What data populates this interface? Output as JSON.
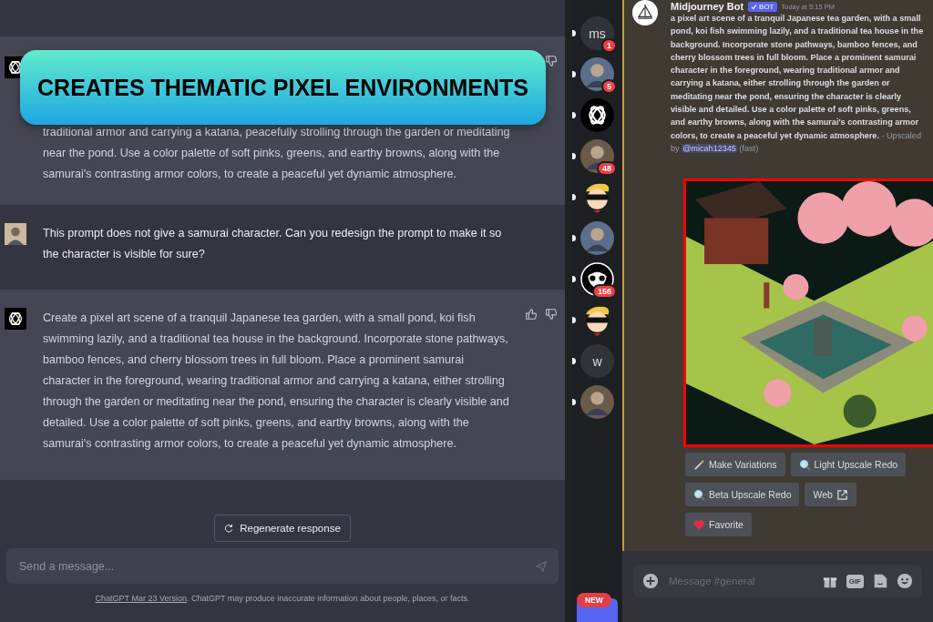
{
  "banner": {
    "text": "CREATES THEMATIC PIXEL ENVIRONMENTS"
  },
  "chat": {
    "messages": [
      {
        "kind": "assistant",
        "text": "traditional armor and carrying a katana, peacefully strolling through the garden or meditating near the pond. Use a color palette of soft pinks, greens, and earthy browns, along with the samurai's contrasting armor colors, to create a peaceful yet dynamic atmosphere."
      },
      {
        "kind": "user",
        "text": "This prompt does not give a samurai character. Can you redesign the prompt to make it so the character is visible for sure?"
      },
      {
        "kind": "assistant",
        "text": "Create a pixel art scene of a tranquil Japanese tea garden, with a small pond, koi fish swimming lazily, and a traditional tea house in the background. Incorporate stone pathways, bamboo fences, and cherry blossom trees in full bloom. Place a prominent samurai character in the foreground, wearing traditional armor and carrying a katana, either strolling through the garden or meditating near the pond, ensuring the character is clearly visible and detailed. Use a color palette of soft pinks, greens, and earthy browns, along with the samurai's contrasting armor colors, to create a peaceful yet dynamic atmosphere."
      }
    ],
    "regenerate_button": "Regenerate response",
    "input": {
      "placeholder": "Send a message..."
    },
    "footer": {
      "link": "ChatGPT Mar 23 Version",
      "text": ". ChatGPT may produce inaccurate information about people, places, or facts."
    }
  },
  "servers": [
    {
      "kind": "text",
      "label": "ms",
      "badge": "1"
    },
    {
      "kind": "avatar",
      "badge": "5"
    },
    {
      "kind": "knot"
    },
    {
      "kind": "avatar",
      "badge": "48"
    },
    {
      "kind": "sunglasses"
    },
    {
      "kind": "avatar"
    },
    {
      "kind": "owl",
      "badge": "156"
    },
    {
      "kind": "sunglasses"
    },
    {
      "kind": "text",
      "label": "w"
    },
    {
      "kind": "avatar"
    }
  ],
  "new_badge": "NEW",
  "discord": {
    "author": "Midjourney Bot",
    "bot_tag": "BOT",
    "timestamp": "Today at 5:15 PM",
    "message": "**a pixel art scene of a tranquil Japanese tea garden, with a small pond, koi fish swimming lazily, and a traditional tea house in the background. Incorporate stone pathways, bamboo fences, and cherry blossom trees in full bloom. Place a prominent samurai character in the foreground, wearing traditional armor and carrying a katana, either strolling through the garden or meditating near the pond, ensuring the character is clearly visible and detailed. Use a color palette of soft pinks, greens, and earthy browns, along with the samurai's contrasting armor colors, to create a peaceful yet dynamic atmosphere.** - Upscaled by",
    "mention": "@micah12345",
    "speed": "(fast)",
    "buttons": [
      {
        "label": "Make Variations",
        "kind": "wand"
      },
      {
        "label": "Light Upscale Redo",
        "kind": "magnifier"
      },
      {
        "label": "Beta Upscale Redo",
        "kind": "magnifier"
      },
      {
        "label": "Web",
        "kind": "external"
      },
      {
        "label": "Favorite",
        "kind": "heart"
      }
    ],
    "input": {
      "placeholder": "Message #general"
    },
    "gif_button": "GIF"
  }
}
